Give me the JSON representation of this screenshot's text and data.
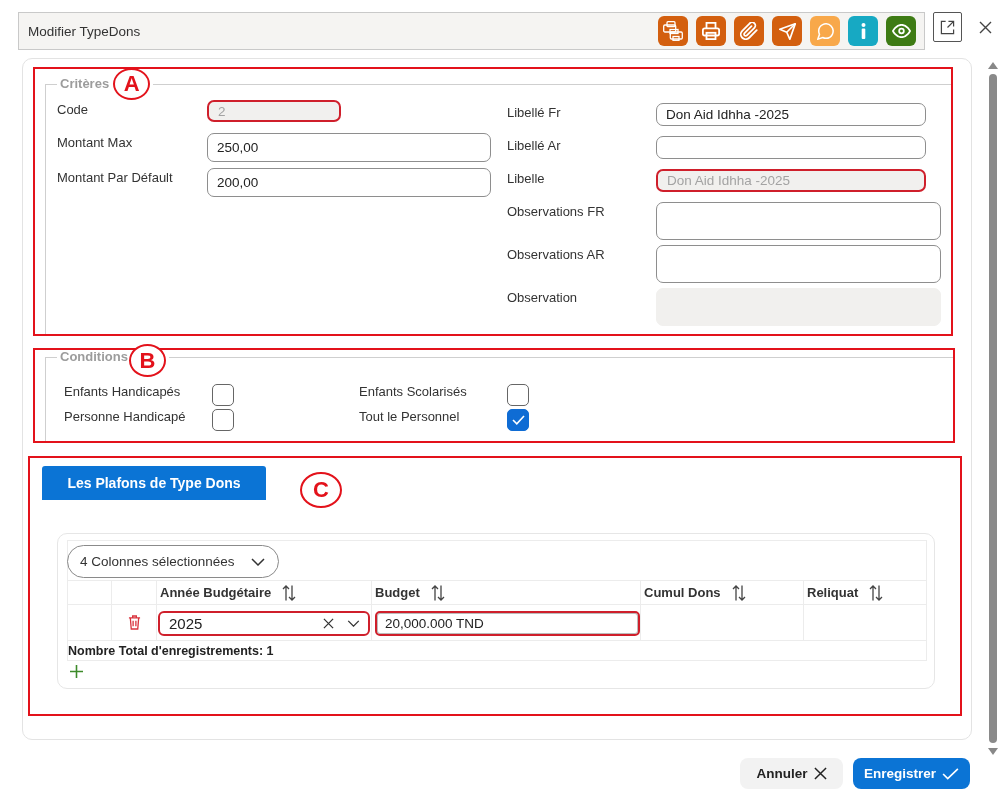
{
  "dialog": {
    "title": "Modifier TypeDons",
    "toolbar": [
      {
        "kind": "documents",
        "color": "#d35f0f"
      },
      {
        "kind": "print",
        "color": "#d35f0f"
      },
      {
        "kind": "attach",
        "color": "#d35f0f"
      },
      {
        "kind": "send",
        "color": "#d35f0f"
      },
      {
        "kind": "comment",
        "color": "#f8a84a"
      },
      {
        "kind": "info",
        "color": "#17a9c3"
      },
      {
        "kind": "view",
        "color": "#3e7b14"
      }
    ]
  },
  "criteria": {
    "legend": "Critères",
    "marker": "A",
    "left_fields": [
      {
        "label": "Code",
        "kind": "short",
        "value": "2",
        "disabled": true,
        "highlighted": true
      },
      {
        "label": "Montant Max",
        "kind": "text",
        "value": "250,00",
        "disabled": false,
        "highlighted": false
      },
      {
        "label": "Montant Par Défault",
        "kind": "text",
        "value": "200,00",
        "disabled": false,
        "highlighted": false
      }
    ],
    "right_fields": [
      {
        "label": "Libellé Fr",
        "kind": "text",
        "value": "Don Aid Idhha -2025",
        "disabled": false,
        "highlighted": false
      },
      {
        "label": "Libellé Ar",
        "kind": "text",
        "disabled": false,
        "highlighted": false
      },
      {
        "label": "Libelle",
        "kind": "text",
        "value": "Don Aid Idhha -2025",
        "disabled": true,
        "highlighted": true
      },
      {
        "label": "Observations FR",
        "kind": "textarea",
        "disabled": false,
        "highlighted": false
      },
      {
        "label": "Observations AR",
        "kind": "textarea",
        "disabled": false,
        "highlighted": false
      },
      {
        "label": "Observation",
        "kind": "textarea",
        "disabled": true,
        "highlighted": false
      }
    ]
  },
  "conditions": {
    "legend": "Conditions",
    "marker": "B",
    "options": [
      {
        "label": "Enfants Handicapés",
        "checked": false
      },
      {
        "label": "Personne Handicapé",
        "checked": false
      },
      {
        "label": "Enfants Scolarisés",
        "checked": false
      },
      {
        "label": "Tout le Personnel",
        "checked": true
      }
    ]
  },
  "plafonds": {
    "marker": "C",
    "tabs": [
      {
        "label": "Les Plafons de Type Dons",
        "selected": true
      }
    ],
    "column_picker": "4 Colonnes sélectionnées",
    "columns": [
      "Année Budgétaire",
      "Budget",
      "Cumul Dons",
      "Reliquat"
    ],
    "rows": [
      {
        "cells": [
          {
            "kind": "select",
            "value": "2025",
            "highlighted": true
          },
          {
            "kind": "input",
            "value": "20,000.000 TND",
            "highlighted": true
          },
          {
            "kind": "blank"
          },
          {
            "kind": "blank"
          }
        ]
      }
    ],
    "total": "Nombre Total d'enregistrements: 1"
  },
  "footer": {
    "buttons": [
      {
        "label": "Annuler",
        "kind": "cancel"
      },
      {
        "label": "Enregistrer",
        "kind": "save"
      }
    ]
  }
}
